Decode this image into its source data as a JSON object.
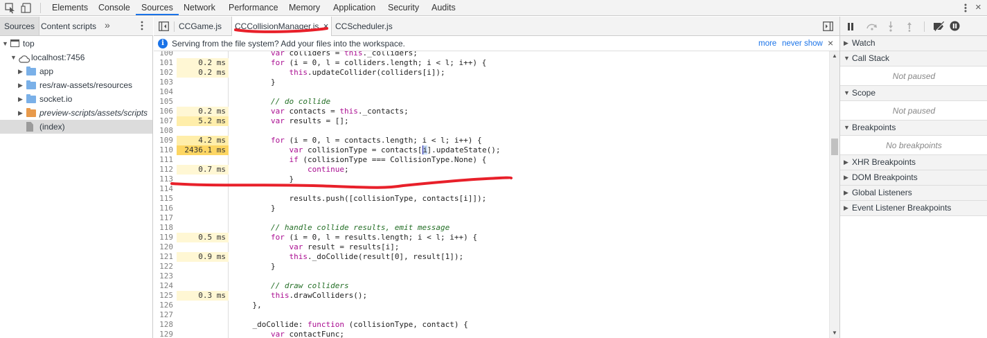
{
  "main_tabs": [
    {
      "label": "Elements"
    },
    {
      "label": "Console"
    },
    {
      "label": "Sources",
      "active": true
    },
    {
      "label": "Network"
    },
    {
      "label": "Performance"
    },
    {
      "label": "Memory"
    },
    {
      "label": "Application"
    },
    {
      "label": "Security"
    },
    {
      "label": "Audits"
    }
  ],
  "navigator": {
    "tabs": [
      "Sources",
      "Content scripts"
    ],
    "overflow_icon": "chevron-double-right-icon",
    "menu_icon": "kebab-menu-icon",
    "tree": [
      {
        "label": "top",
        "icon": "frame-icon"
      },
      {
        "label": "localhost:7456",
        "icon": "cloud-icon"
      },
      {
        "label": "app",
        "icon": "folder-icon",
        "color": "#7ab0e8"
      },
      {
        "label": "res/raw-assets/resources",
        "icon": "folder-icon",
        "color": "#7ab0e8"
      },
      {
        "label": "socket.io",
        "icon": "folder-icon",
        "color": "#7ab0e8"
      },
      {
        "label": "preview-scripts/assets/scripts",
        "icon": "folder-icon",
        "color": "#e89a4b"
      },
      {
        "label": "(index)",
        "icon": "file-icon"
      }
    ]
  },
  "editor": {
    "tabs": [
      {
        "label": "CCGame.js"
      },
      {
        "label": "CCCollisionManager.js",
        "active": true,
        "close": "×"
      },
      {
        "label": "CCScheduler.js"
      }
    ],
    "infobar": {
      "message": "Serving from the file system? Add your files into the workspace.",
      "more": "more",
      "never": "never show",
      "close": "×"
    },
    "lines": [
      {
        "n": "100",
        "t": "",
        "c": "        var colliders = this._colliders;"
      },
      {
        "n": "101",
        "t": "0.2 ms",
        "c": "        for (i = 0, l = colliders.length; i < l; i++) {"
      },
      {
        "n": "102",
        "t": "0.2 ms",
        "c": "            this.updateCollider(colliders[i]);"
      },
      {
        "n": "103",
        "t": "",
        "c": "        }"
      },
      {
        "n": "104",
        "t": "",
        "c": ""
      },
      {
        "n": "105",
        "t": "",
        "c": "        // do collide"
      },
      {
        "n": "106",
        "t": "0.2 ms",
        "c": "        var contacts = this._contacts;"
      },
      {
        "n": "107",
        "t": "5.2 ms",
        "c": "        var results = [];"
      },
      {
        "n": "108",
        "t": "",
        "c": ""
      },
      {
        "n": "109",
        "t": "4.2 ms",
        "c": "        for (i = 0, l = contacts.length; i < l; i++) {"
      },
      {
        "n": "110",
        "t": "2436.1 ms",
        "c": "            var collisionType = contacts[i].updateState();"
      },
      {
        "n": "111",
        "t": "",
        "c": "            if (collisionType === CollisionType.None) {"
      },
      {
        "n": "112",
        "t": "0.7 ms",
        "c": "                continue;"
      },
      {
        "n": "113",
        "t": "",
        "c": "            }"
      },
      {
        "n": "114",
        "t": "",
        "c": ""
      },
      {
        "n": "115",
        "t": "",
        "c": "            results.push([collisionType, contacts[i]]);"
      },
      {
        "n": "116",
        "t": "",
        "c": "        }"
      },
      {
        "n": "117",
        "t": "",
        "c": ""
      },
      {
        "n": "118",
        "t": "",
        "c": "        // handle collide results, emit message"
      },
      {
        "n": "119",
        "t": "0.5 ms",
        "c": "        for (i = 0, l = results.length; i < l; i++) {"
      },
      {
        "n": "120",
        "t": "",
        "c": "            var result = results[i];"
      },
      {
        "n": "121",
        "t": "0.9 ms",
        "c": "            this._doCollide(result[0], result[1]);"
      },
      {
        "n": "122",
        "t": "",
        "c": "        }"
      },
      {
        "n": "123",
        "t": "",
        "c": ""
      },
      {
        "n": "124",
        "t": "",
        "c": "        // draw colliders"
      },
      {
        "n": "125",
        "t": "0.3 ms",
        "c": "        this.drawColliders();"
      },
      {
        "n": "126",
        "t": "",
        "c": "    },"
      },
      {
        "n": "127",
        "t": "",
        "c": ""
      },
      {
        "n": "128",
        "t": "",
        "c": "    _doCollide: function (collisionType, contact) {"
      },
      {
        "n": "129",
        "t": "",
        "c": "        var contactFunc;"
      }
    ]
  },
  "sidebar": {
    "panes": [
      {
        "title": "Watch",
        "open": false
      },
      {
        "title": "Call Stack",
        "open": true,
        "body": "Not paused"
      },
      {
        "title": "Scope",
        "open": true,
        "body": "Not paused"
      },
      {
        "title": "Breakpoints",
        "open": true,
        "body": "No breakpoints"
      },
      {
        "title": "XHR Breakpoints",
        "open": false
      },
      {
        "title": "DOM Breakpoints",
        "open": false
      },
      {
        "title": "Global Listeners",
        "open": false
      },
      {
        "title": "Event Listener Breakpoints",
        "open": false
      }
    ]
  },
  "colors": {
    "accent": "#1a73e8",
    "annotation": "#e8202a",
    "heat_hot": "#fdd663",
    "heat_warm": "#ffeeaa",
    "heat_mild": "#fff7d4"
  }
}
